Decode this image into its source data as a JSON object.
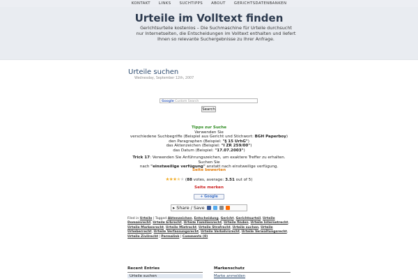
{
  "nav": {
    "items": [
      "KONTAKT",
      "LINKS",
      "SUCHTIPPS",
      "ABOUT",
      "GERICHTSDATENBANKEN"
    ]
  },
  "header": {
    "title": "Urteile im Volltext finden",
    "description": "Gerichtsurteile kostenlos – Die Suchmaschine für Urteile durchsucht nur Internetseiten, die Entscheidungen im Volltext enthalten und liefert Ihnen so relevante Suchergebnisse zu Ihrer Anfrage."
  },
  "post": {
    "title": "Urteile suchen",
    "date": "Wednesday, September 12th, 2007"
  },
  "search": {
    "placeholder_google": "Google",
    "placeholder_rest": "Custom Search",
    "button_label": "Search"
  },
  "tips": {
    "heading": "Tipps zur Suche",
    "line1": "Verwenden Sie",
    "line2_pre": "verschiedene Suchbegriffe (Beispiel aus Gericht und Stichwort: ",
    "line2_bold": "BGH Paperboy",
    "line2_post": ")",
    "line3_pre": "den Paragraphen (Beispiel: ",
    "line3_bold": "\"§ 15 UrhG\"",
    "line3_post": ")",
    "line4_pre": "das Aktenzeichen (Beispiel: ",
    "line4_bold": "\"I ZR 259/00\"",
    "line4_post": ")",
    "line5_pre": "das Datum (Beispiel: ",
    "line5_bold": "\"17.07.2003\"",
    "line5_post": ")",
    "trick_label": "Trick 17",
    "trick_text1": ": Verwenden Sie Anführungszeichen, um exaktere Treffer zu erhalten. Suchen Sie",
    "trick_text2_pre": "nach ",
    "trick_text2_bold": "\"einstweilige verfügung\"",
    "trick_text2_post": " anstatt nach einstweilige verfügung."
  },
  "rating": {
    "heading": "Seite bewerten",
    "stars_value": 3.51,
    "stars_max": 5,
    "votes": "88",
    "text_pre": "(",
    "text_mid": " votes, average: ",
    "average": "3.51",
    "text_post": " out of 5)"
  },
  "bookmark": {
    "heading": "Seite merken",
    "google_label": "Google",
    "share_label": "Share / Save"
  },
  "meta": {
    "filed_in": "Filed in",
    "category": "Urteile",
    "tagged": "Tagged",
    "tags": [
      "Aktenzeichen",
      "Entscheidung",
      "Gericht",
      "Gerichtsurteil",
      "Urteile Domainrecht",
      "Urteile Erbrecht",
      "Urteile Familienrecht",
      "Urteile finden",
      "Urteile Internetrecht",
      "Urteile Markenrecht",
      "Urteile Mietrecht",
      "Urteile Strafrecht",
      "Urteile suchen",
      "Urteile Urheberrecht",
      "Urteile Verfassungsrecht",
      "Urteile Verkehrsrecht",
      "Urteile Verwaltungsrecht",
      "Urteile Zivilrecht"
    ],
    "permalink": "Permalink",
    "comments": "Comments (0)"
  },
  "sidebar": {
    "left_heading": "Recent Entries",
    "left_item": "Urteile suchen",
    "right_heading": "Markenschutz",
    "right_item": "Marke anmelden"
  },
  "colors": {
    "accent": "#2c4a6e",
    "header_bg": "#e9ecf1",
    "tip_green": "#2b8a1e",
    "rating_orange": "#e27d0c",
    "bookmark_red": "#cc1f1f"
  }
}
